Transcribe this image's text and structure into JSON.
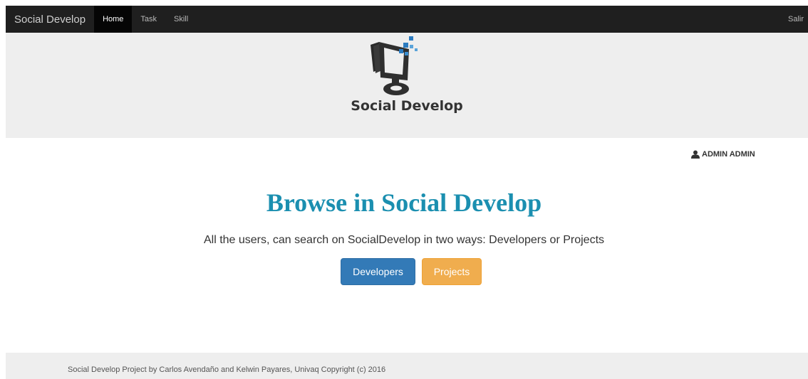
{
  "navbar": {
    "brand": "Social Develop",
    "items": [
      {
        "label": "Home",
        "active": true
      },
      {
        "label": "Task",
        "active": false
      },
      {
        "label": "Skill",
        "active": false
      }
    ],
    "logout": "Salir"
  },
  "header": {
    "logo_text": "Social Develop",
    "logo_icon": "monitor-logo-icon"
  },
  "user": {
    "icon": "user-icon",
    "name": "ADMIN ADMIN"
  },
  "main": {
    "title": "Browse in Social Develop",
    "description": "All the users, can search on SocialDevelop in two ways: Developers or Projects",
    "buttons": {
      "developers": "Developers",
      "projects": "Projects"
    }
  },
  "footer": {
    "text": "Social Develop Project by Carlos Avendaño and Kelwin Payares, Univaq Copyright (c) 2016"
  },
  "colors": {
    "navbar_bg": "#1f1f1f",
    "jumbotron_bg": "#eeeeee",
    "title": "#1b8fb0",
    "primary": "#337ab7",
    "warning": "#f0ad4e"
  }
}
